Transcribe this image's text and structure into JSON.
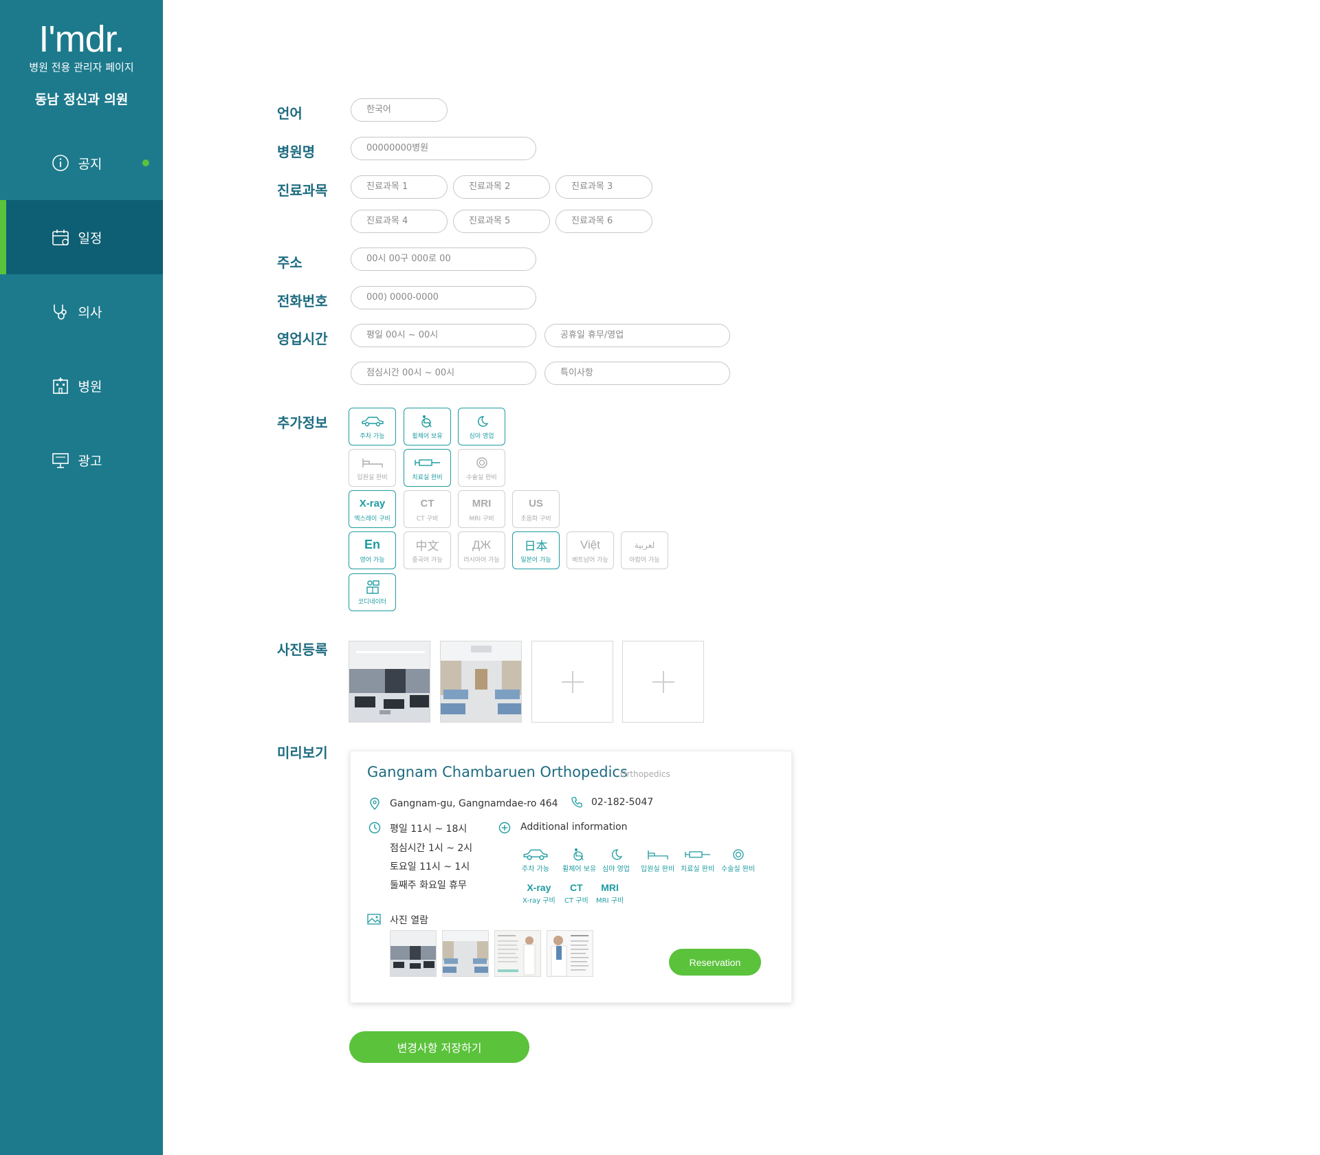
{
  "sidebar": {
    "logo": "I'mdr.",
    "subtitle": "병원 전용 관리자 페이지",
    "hospital": "동남 정신과 의원",
    "items": [
      {
        "label": "공지",
        "icon": "info-icon"
      },
      {
        "label": "일정",
        "icon": "calendar-icon"
      },
      {
        "label": "의사",
        "icon": "stethoscope-icon"
      },
      {
        "label": "병원",
        "icon": "hospital-icon"
      },
      {
        "label": "광고",
        "icon": "billboard-icon"
      }
    ]
  },
  "form": {
    "language": {
      "label": "언어",
      "value": "한국어"
    },
    "name": {
      "label": "병원명",
      "value": "00000000병원"
    },
    "departments": {
      "label": "진료과목",
      "values": [
        "진료과목 1",
        "진료과목 2",
        "진료과목 3",
        "진료과목 4",
        "진료과목 5",
        "진료과목 6"
      ]
    },
    "address": {
      "label": "주소",
      "value": "00시 00구 000로 00"
    },
    "phone": {
      "label": "전화번호",
      "value": "000) 0000-0000"
    },
    "hours": {
      "label": "영업시간",
      "values": [
        "평일 00시 ~ 00시",
        "공휴일 휴무/영업",
        "점심시간 00시 ~ 00시",
        "특이사항"
      ]
    },
    "extra_label": "추가정보",
    "features": [
      {
        "label": "주차 가능",
        "icon": "car-icon"
      },
      {
        "label": "휠체어 보유",
        "icon": "wheelchair-icon"
      },
      {
        "label": "심야 영업",
        "icon": "moon-icon"
      },
      {
        "label": "입원실 완비",
        "icon": "bed-icon"
      },
      {
        "label": "치료실 완비",
        "icon": "syringe-icon"
      },
      {
        "label": "수술실 완비",
        "icon": "surgery-icon"
      },
      {
        "label": "엑스레이 구비",
        "code": "X-ray"
      },
      {
        "label": "CT 구비",
        "code": "CT"
      },
      {
        "label": "MRI 구비",
        "code": "MRI"
      },
      {
        "label": "초음파 구비",
        "code": "US"
      },
      {
        "label": "영어 가능",
        "code": "En"
      },
      {
        "label": "중국어 가능",
        "code": "中文"
      },
      {
        "label": "러시아어 가능",
        "code": "ДЖ"
      },
      {
        "label": "일본어 가능",
        "code": "日本"
      },
      {
        "label": "베트남어 가능",
        "code": "Việt"
      },
      {
        "label": "아랍어 가능",
        "code": "لعربية"
      },
      {
        "label": "코디네이터",
        "icon": "coordinator-icon"
      }
    ],
    "photos_label": "사진등록",
    "preview_label": "미리보기",
    "save_label": "변경사항 저장하기"
  },
  "preview": {
    "name": "Gangnam Chambaruen Orthopedics",
    "department": "Orthopedics",
    "address": "Gangnam-gu, Gangnamdae-ro 464",
    "phone": "02-182-5047",
    "hours": [
      "평일 11시 ~ 18시",
      "점심시간 1시 ~ 2시",
      "토요일 11시 ~ 1시",
      "둘째주 화요일 휴무"
    ],
    "additional_info": "Additional information",
    "amenities": [
      "주차 가능",
      "휠체어 보유",
      "심야 영업",
      "입원실 완비",
      "치료실 완비",
      "수술실 완비"
    ],
    "equipment": [
      {
        "code": "X-ray",
        "label": "X-ray 구비"
      },
      {
        "code": "CT",
        "label": "CT 구비"
      },
      {
        "code": "MRI",
        "label": "MRI 구비"
      }
    ],
    "gallery_label": "사진 열람",
    "reservation_label": "Reservation"
  },
  "colors": {
    "sidebar": "#1d7a8c",
    "sidebar_active": "#0e5f73",
    "accent": "#5bc23c",
    "teal": "#1e9ba0",
    "label": "#1d6b80"
  }
}
